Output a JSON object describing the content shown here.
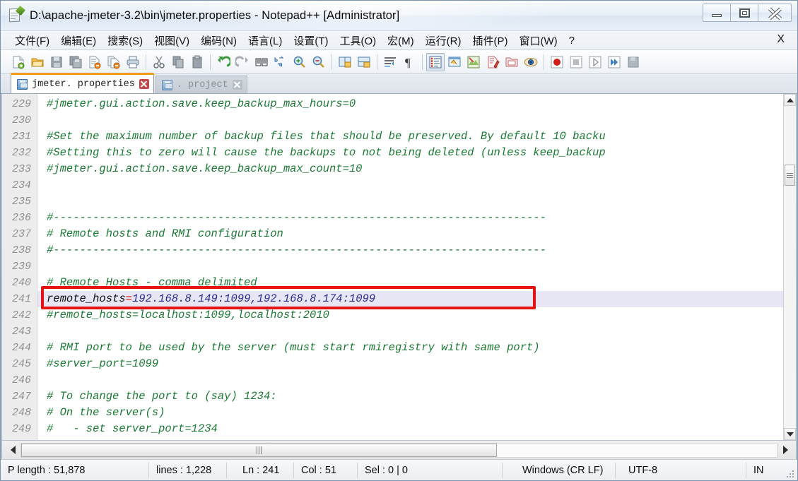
{
  "window": {
    "title": "D:\\apache-jmeter-3.2\\bin\\jmeter.properties - Notepad++ [Administrator]",
    "icon": "notepad-plus-plus-icon",
    "minimize_label": "–",
    "maximize_label": "□",
    "close_label": "✕"
  },
  "menu": {
    "items": [
      {
        "label": "文件(F)",
        "name": "menu-file"
      },
      {
        "label": "编辑(E)",
        "name": "menu-edit"
      },
      {
        "label": "搜索(S)",
        "name": "menu-search"
      },
      {
        "label": "视图(V)",
        "name": "menu-view"
      },
      {
        "label": "编码(N)",
        "name": "menu-encoding"
      },
      {
        "label": "语言(L)",
        "name": "menu-language"
      },
      {
        "label": "设置(T)",
        "name": "menu-settings"
      },
      {
        "label": "工具(O)",
        "name": "menu-tools"
      },
      {
        "label": "宏(M)",
        "name": "menu-macro"
      },
      {
        "label": "运行(R)",
        "name": "menu-run"
      },
      {
        "label": "插件(P)",
        "name": "menu-plugins"
      },
      {
        "label": "窗口(W)",
        "name": "menu-window"
      },
      {
        "label": "?",
        "name": "menu-help"
      }
    ],
    "close_doc": "X"
  },
  "toolbar": {
    "icons": [
      "new-file-icon",
      "open-file-icon",
      "save-icon",
      "save-all-icon",
      "close-file-icon",
      "close-all-icon",
      "print-icon",
      "SEP",
      "cut-icon",
      "copy-icon",
      "paste-icon",
      "SEP",
      "undo-icon",
      "redo-icon",
      "find-icon",
      "replace-icon",
      "zoom-in-icon",
      "zoom-out-icon",
      "SEP",
      "sync-vertical-icon",
      "sync-horizontal-icon",
      "word-wrap-icon",
      "show-all-chars-icon",
      "SEP",
      "indent-guide-icon",
      "user-defined-dialog-icon",
      "show-doc-map-icon",
      "function-list-icon",
      "folder-as-workspace-icon",
      "monitoring-icon",
      "SEP",
      "record-macro-icon",
      "stop-record-icon",
      "play-macro-icon",
      "run-macro-multiple-icon",
      "save-macro-icon"
    ]
  },
  "tabs": [
    {
      "label": "jmeter. properties",
      "active": true,
      "dirty": true,
      "name": "tab-jmeter-properties"
    },
    {
      "label": ". project",
      "active": false,
      "dirty": false,
      "name": "tab-dot-project"
    }
  ],
  "editor": {
    "first_line": 229,
    "highlight_line": 241,
    "lines": [
      {
        "n": 229,
        "text": "#jmeter.gui.action.save.keep_backup_max_hours=0"
      },
      {
        "n": 230,
        "text": ""
      },
      {
        "n": 231,
        "text": "#Set the maximum number of backup files that should be preserved. By default 10 backu"
      },
      {
        "n": 232,
        "text": "#Setting this to zero will cause the backups to not being deleted (unless keep_backup"
      },
      {
        "n": 233,
        "text": "#jmeter.gui.action.save.keep_backup_max_count=10"
      },
      {
        "n": 234,
        "text": ""
      },
      {
        "n": 235,
        "text": ""
      },
      {
        "n": 236,
        "text": "#---------------------------------------------------------------------------"
      },
      {
        "n": 237,
        "text": "# Remote hosts and RMI configuration"
      },
      {
        "n": 238,
        "text": "#---------------------------------------------------------------------------"
      },
      {
        "n": 239,
        "text": ""
      },
      {
        "n": 240,
        "text": "# Remote Hosts - comma delimited"
      },
      {
        "n": 241,
        "text": "remote_hosts=192.168.8.149:1099,192.168.8.174:1099",
        "key": "remote_hosts",
        "eq": "=",
        "value": "192.168.8.149:1099,192.168.8.174:1099",
        "highlight": true
      },
      {
        "n": 242,
        "text": "#remote_hosts=localhost:1099,localhost:2010"
      },
      {
        "n": 243,
        "text": ""
      },
      {
        "n": 244,
        "text": "# RMI port to be used by the server (must start rmiregistry with same port)"
      },
      {
        "n": 245,
        "text": "#server_port=1099"
      },
      {
        "n": 246,
        "text": ""
      },
      {
        "n": 247,
        "text": "# To change the port to (say) 1234:"
      },
      {
        "n": 248,
        "text": "# On the server(s)"
      },
      {
        "n": 249,
        "text": "#   - set server_port=1234"
      }
    ],
    "comment_color": "#1a7a33",
    "key_color": "#101010",
    "operator_color": "#e01010",
    "value_color": "#2b2b8f",
    "highlight_bg": "#e6e6f5",
    "annotation_box_color": "#e71313"
  },
  "statusbar": {
    "length_label": "P length : 51,878",
    "lines_label": "lines : 1,228",
    "ln_label": "Ln : 241",
    "col_label": "Col : 51",
    "sel_label": "Sel : 0 | 0",
    "eol_label": "Windows (CR LF)",
    "encoding_label": "UTF-8",
    "insert_label": "IN"
  }
}
